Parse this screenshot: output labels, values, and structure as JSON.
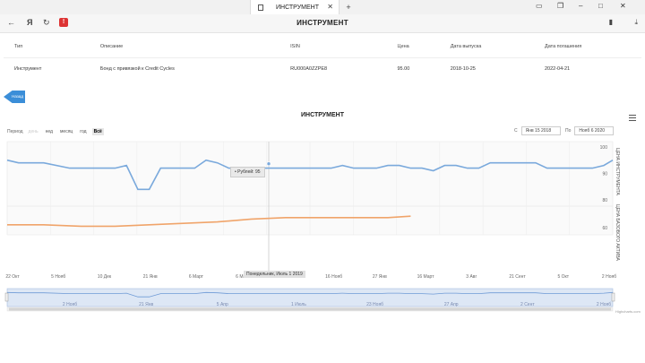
{
  "browser": {
    "tab_title": "ИНСТРУМЕНТ",
    "close_glyph": "✕",
    "newtab_glyph": "+"
  },
  "page": {
    "title": "ИНСТРУМЕНТ"
  },
  "table": {
    "headers": [
      "Тип",
      "Описание",
      "ISIN",
      "Цена",
      "Дата выпуска",
      "Дата погашения"
    ],
    "row": [
      "Инструмент",
      "Бонд с привязкой к Credit Cycles",
      "RU000A0ZZPE8",
      "95.00",
      "2018-10-25",
      "2022-04-21"
    ]
  },
  "back_button": {
    "label": "Назад"
  },
  "chart_section": {
    "title": "ИНСТРУМЕНТ",
    "period_label": "Период",
    "period_buttons": [
      "день",
      "нед",
      "месяц",
      "год",
      "Всё"
    ],
    "from_label": "С",
    "from_value": "Янв 15 2018",
    "to_label": "По",
    "to_value": "Нояб 6 2020",
    "axis_price": "ЦЕНА ИНСТРУМЕНТА",
    "axis_base": "ЦЕНА БАЗОВОГО АКТИВА",
    "tooltip": "• Рублей: 95",
    "crosshair_label": "Понедельник, Июль 1 2019",
    "credits": "Highcharts.com"
  },
  "chart_data": {
    "type": "line",
    "series": [
      {
        "color": "#7aa9dc",
        "x": [
          "2018-10-22",
          "2018-11-05",
          "2018-11-19",
          "2018-12-06",
          "2019-01-07",
          "2019-01-21",
          "2019-02-04",
          "2019-02-18",
          "2019-03-04",
          "2019-03-18",
          "2019-04-01",
          "2019-04-15",
          "2019-04-29",
          "2019-05-13",
          "2019-05-27",
          "2019-06-10",
          "2019-06-24",
          "2019-07-08",
          "2019-07-22",
          "2019-08-05",
          "2019-08-19",
          "2019-09-02",
          "2019-09-16",
          "2019-09-30",
          "2019-10-14",
          "2019-10-28",
          "2019-11-11",
          "2019-11-25",
          "2019-12-09",
          "2019-12-23",
          "2020-01-06",
          "2020-01-20",
          "2020-02-03",
          "2020-02-17",
          "2020-03-02",
          "2020-03-16",
          "2020-03-30",
          "2020-04-13",
          "2020-04-27",
          "2020-05-11",
          "2020-05-25",
          "2020-06-08",
          "2020-06-22",
          "2020-07-06",
          "2020-07-20",
          "2020-08-03",
          "2020-08-17",
          "2020-08-31",
          "2020-09-14",
          "2020-09-28",
          "2020-10-12",
          "2020-10-26",
          "2020-11-06"
        ],
        "y": [
          95,
          94,
          94,
          94,
          92,
          92,
          92,
          92,
          92,
          93,
          84,
          84,
          92,
          92,
          92,
          92,
          95,
          94,
          92,
          92,
          92,
          92,
          92,
          92,
          92,
          92,
          92,
          92,
          93,
          92,
          92,
          92,
          93,
          93,
          92,
          92,
          91,
          93,
          93,
          92,
          92,
          94,
          94,
          94,
          94,
          94,
          92,
          92,
          92,
          92,
          92,
          93,
          95
        ]
      },
      {
        "color": "#f0a46a",
        "x": [
          "2018-10-22",
          "2018-12-06",
          "2019-01-21",
          "2019-03-04",
          "2019-04-15",
          "2019-05-27",
          "2019-07-08",
          "2019-08-19",
          "2019-09-30",
          "2019-11-11",
          "2019-12-23",
          "2020-02-03",
          "2020-03-02"
        ],
        "y": [
          62,
          62,
          61,
          61,
          62,
          63,
          64,
          66,
          67,
          67,
          67,
          67,
          68
        ]
      }
    ],
    "x_ticks": [
      "22 Окт",
      "5 Нояб",
      "10 Дек",
      "21 Янв",
      "6 Март",
      "6 Май",
      "1 Июль",
      "16 Нояб",
      "27 Янв",
      "16 Март",
      "3 Авг",
      "21 Сент",
      "5 Окт",
      "2 Нояб"
    ],
    "y_ticks_top": [
      80,
      90,
      100
    ],
    "y_ticks_bottom": [
      60
    ],
    "navigator_ticks": [
      "2 Нояб",
      "21 Янв",
      "5 Апр",
      "1 Июль",
      "23 Нояб",
      "27 Апр",
      "2 Сент",
      "2 Нояб"
    ]
  }
}
